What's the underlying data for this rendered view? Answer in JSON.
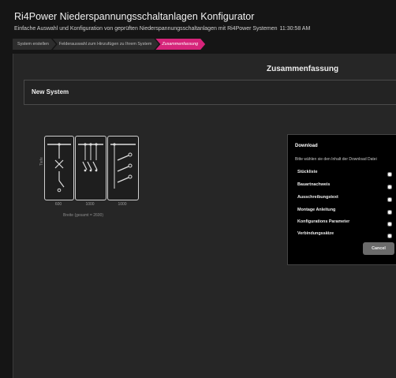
{
  "header": {
    "title": "Ri4Power Niederspannungsschaltanlagen Konfigurator",
    "subtitle": "Einfache Auswahl und Konfiguration von geprüften Niederspannungsschaltanlagen mit Ri4Power Systemen",
    "time": "11:30:58 AM"
  },
  "wizard": {
    "steps": [
      {
        "label": "System erstellen"
      },
      {
        "label": "Felderauswahl zum Hinzufügen zu Ihrem System"
      },
      {
        "label": "Zusammenfassung"
      }
    ]
  },
  "summary": {
    "title": "Zusammenfassung",
    "system_name": "New System"
  },
  "diagram": {
    "height_label": "Tiefe",
    "widths": [
      "600",
      "1000",
      "1000"
    ],
    "total_label": "Breite (gesamt = 2600)"
  },
  "download": {
    "title": "Download",
    "hint": "Bitte wählen sie den Inhalt der Download Datei",
    "items": [
      {
        "label": "Stückliste"
      },
      {
        "label": "Bauartnachweis"
      },
      {
        "label": "Ausschreibungstext"
      },
      {
        "label": "Montage Anleitung"
      },
      {
        "label": "Konfigurations Parameter"
      },
      {
        "label": "Verbindungssätze"
      }
    ],
    "cancel_label": "Cancel"
  },
  "colors": {
    "accent": "#d6247a",
    "background": "#151515",
    "panel": "#262626"
  }
}
